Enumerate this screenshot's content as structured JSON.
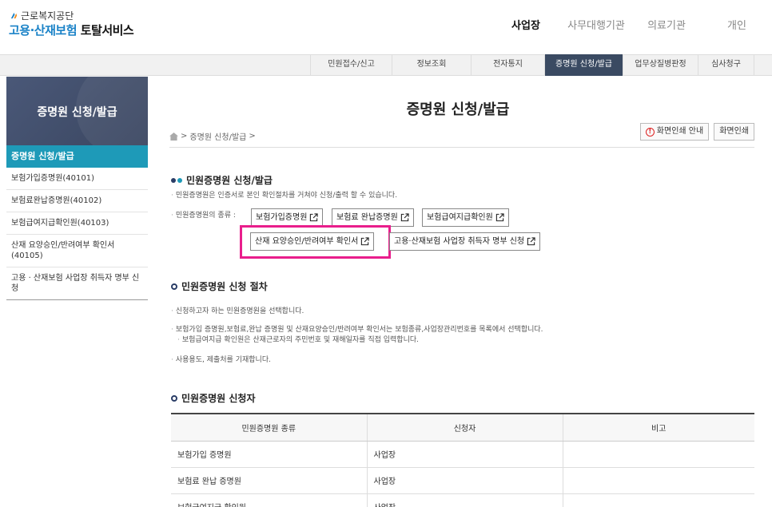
{
  "header": {
    "org_name": "근로복지공단",
    "title_part1": "고용·산재보험",
    "title_part2": "토탈서비스",
    "nav": [
      {
        "label": "사업장",
        "active": true
      },
      {
        "label": "사무대행기관",
        "active": false
      },
      {
        "label": "의료기관",
        "active": false
      },
      {
        "label": "개인",
        "active": false
      }
    ]
  },
  "subnav": [
    {
      "label": "민원접수/신고",
      "active": false
    },
    {
      "label": "정보조회",
      "active": false
    },
    {
      "label": "전자통지",
      "active": false
    },
    {
      "label": "증명원 신청/발급",
      "active": true
    },
    {
      "label": "업무상질병판정",
      "active": false
    },
    {
      "label": "심사청구",
      "active": false
    }
  ],
  "sidebar": {
    "banner_title": "증명원 신청/발급",
    "active_label": "증명원 신청/발급",
    "items": [
      "보험가입증명원(40101)",
      "보험료완납증명원(40102)",
      "보험급여지급확인원(40103)",
      "산재 요양승인/반려여부 확인서 (40105)",
      "고용 · 산재보험 사업장 취득자 명부 신청"
    ]
  },
  "main": {
    "page_title": "증명원 신청/발급",
    "breadcrumb": "증명원 신청/발급",
    "breadcrumb_sep": ">",
    "print_guide": "화면인쇄 안내",
    "print": "화면인쇄",
    "section1": {
      "title": "민원증명원 신청/발급",
      "desc": "민원증명원은 인증서로 본인 확인절차를 거쳐야 신청/출력 할 수 있습니다.",
      "types_label": "민원증명원의 종류 :",
      "buttons": [
        "보험가입증명원",
        "보험료 완납증명원",
        "보험급여지급확인원",
        "산재 요양승인/반려여부 확인서",
        "고용·산재보험 사업장 취득자 명부 신청"
      ]
    },
    "section2": {
      "title": "민원증명원 신청 절차",
      "bullets": [
        "신청하고자 하는 민원증명원을 선택합니다.",
        "보험가입 증명원,보험료,완납 증명원 및 산재요양승인/반려여부 확인서는 보험종류,사업장관리번호를 목록에서 선택합니다.",
        "보험급여지급 확인원은 산재근로자의 주민번호 및 재해일자를 직접 입력합니다.",
        "사용용도, 제출처를 기재합니다."
      ]
    },
    "section3": {
      "title": "민원증명원 신청자",
      "columns": [
        "민원증명원 종류",
        "신청자",
        "비고"
      ],
      "rows": [
        [
          "보험가입 증명원",
          "사업장",
          ""
        ],
        [
          "보험료 완납 증명원",
          "사업장",
          ""
        ],
        [
          "보험급여지급 확인원",
          "사업장",
          ""
        ]
      ]
    }
  },
  "colors": {
    "accent_blue": "#1a82c7",
    "sidebar_active": "#1e9ab8",
    "subnav_active": "#3a4a62",
    "highlight": "#e91e8c"
  }
}
